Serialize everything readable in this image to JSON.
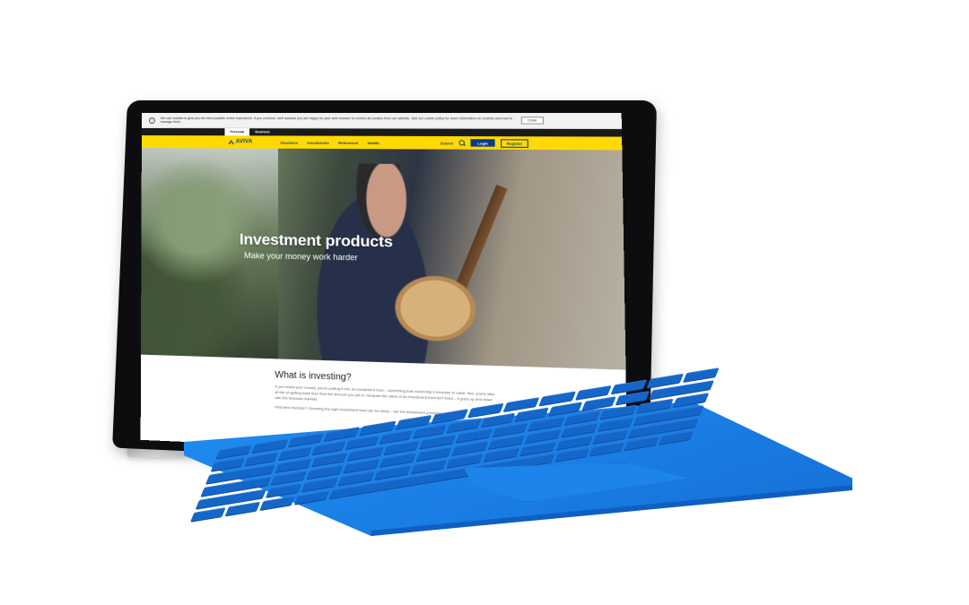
{
  "cookie_bar": {
    "text": "We use cookies to give you the best possible online experience. If you continue, we'll assume you are happy for your web browser to receive all cookies from our website. See our cookie policy for more information on cookies and how to manage them.",
    "close_label": "Close"
  },
  "segments": [
    "Personal",
    "Business"
  ],
  "nav": {
    "logo": "AVIVA",
    "items": [
      "Insurance",
      "Investments",
      "Retirement",
      "Health"
    ],
    "search_label": "Search",
    "login_label": "Login",
    "register_label": "Register"
  },
  "hero": {
    "title": "Investment products",
    "subtitle": "Make your money work harder"
  },
  "content": {
    "heading": "What is investing?",
    "para1": "If you invest your money, you're putting it into an investment fund – something that could help it increase in value. But, you're also at risk of getting back less than the amount you put in, because the value of an investment fund isn't fixed – it goes up and down with the financial markets.",
    "para2": "First-time investor? Choosing the right investment fund can be tricky – but the investment products we offer are"
  },
  "colors": {
    "brand_yellow": "#ffd900",
    "brand_blue": "#0a3b84",
    "keyboard_blue": "#1a7fe6"
  }
}
